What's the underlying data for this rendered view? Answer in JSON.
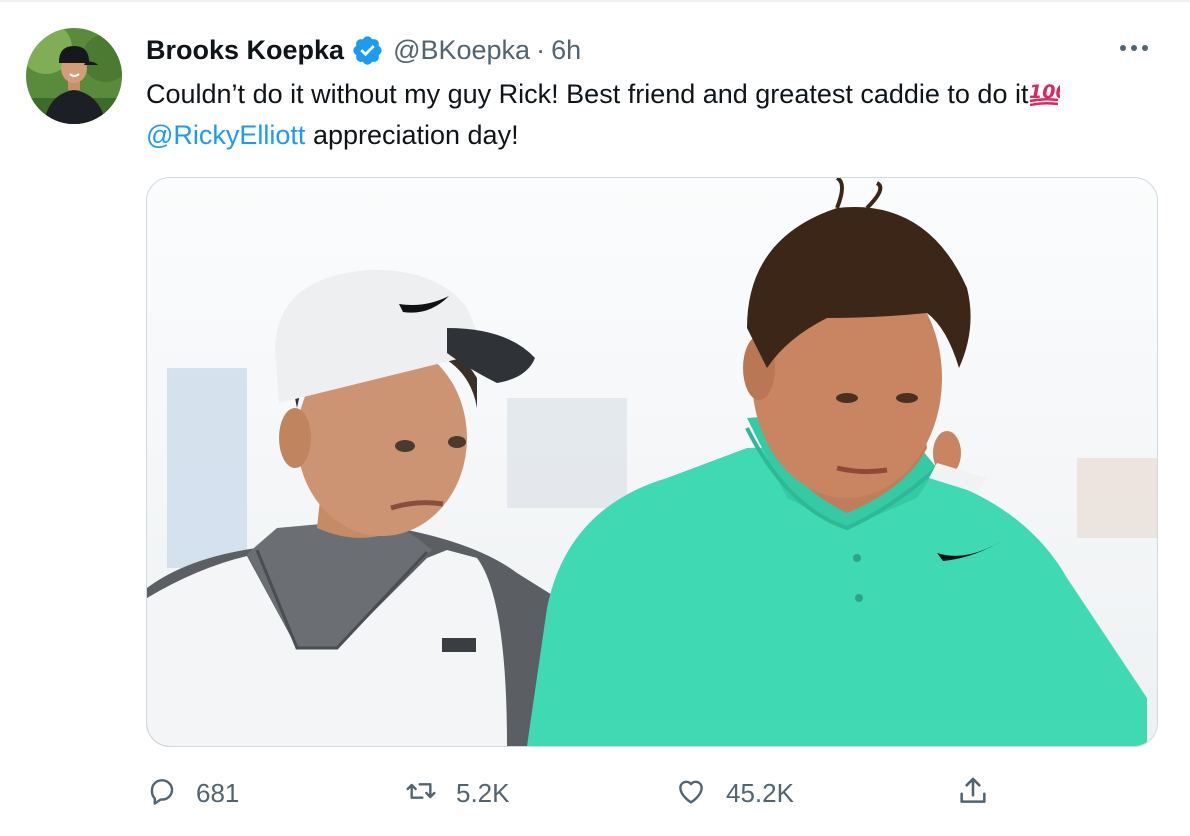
{
  "tweet": {
    "author_name": "Brooks Koepka",
    "author_handle": "@BKoepka",
    "separator": "·",
    "time": "6h",
    "text_part1": "Couldn’t do it without my guy Rick! Best friend and greatest caddie to do it",
    "emoji_name": "hundred-points-emoji",
    "mention": "@RickyElliott",
    "text_part2": " appreciation day!",
    "verified": true,
    "media_description_icon": "photo",
    "actions": {
      "reply_count": "681",
      "retweet_count": "5.2K",
      "like_count": "45.2K"
    },
    "icons": {
      "verified": "verified-badge-icon",
      "more": "more-options-icon",
      "reply": "reply-icon",
      "retweet": "retweet-icon",
      "like": "like-icon",
      "share": "share-icon"
    }
  },
  "colors": {
    "accent": "#1d9bf0",
    "text_primary": "#0f1419",
    "text_secondary": "#536471",
    "border": "#cfd9de"
  }
}
